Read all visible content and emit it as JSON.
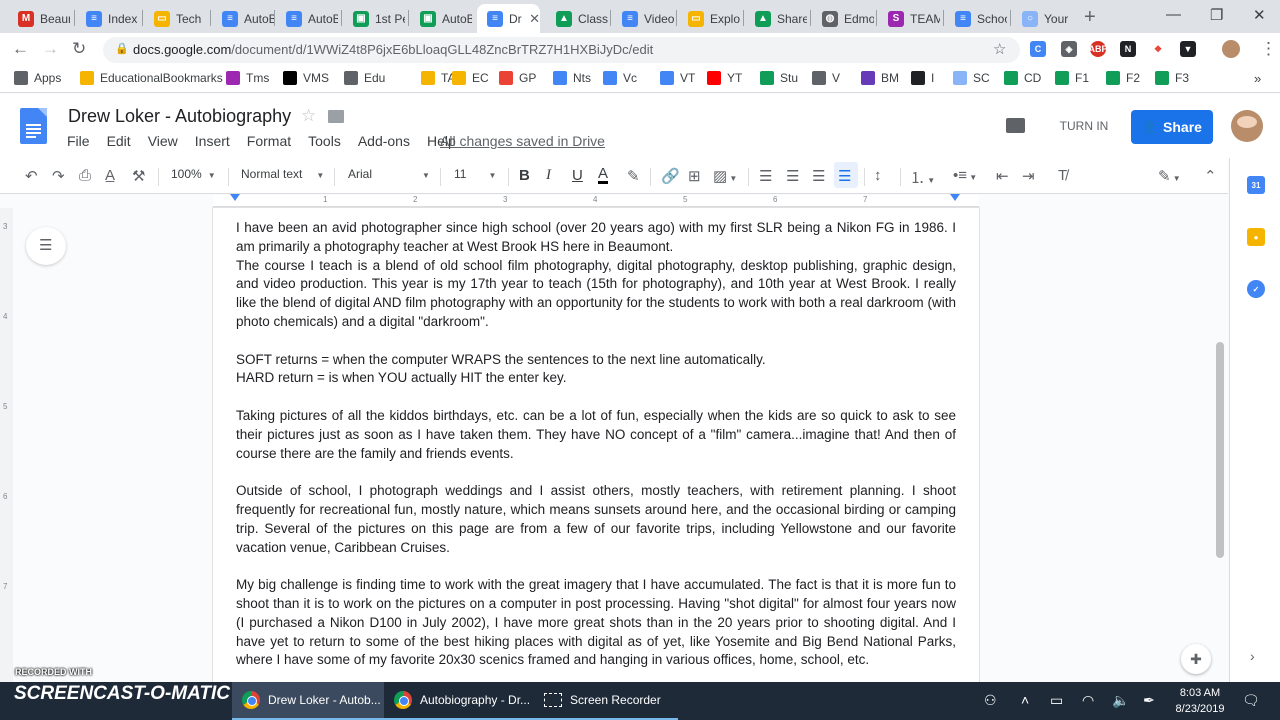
{
  "browser": {
    "tabs": [
      {
        "label": "Beaum",
        "icon": "gmail-icon",
        "color": "#d93025",
        "glyph": "M"
      },
      {
        "label": "Index",
        "icon": "docs-icon",
        "color": "#4285f4",
        "glyph": "≡"
      },
      {
        "label": "Tech",
        "icon": "slides-icon",
        "color": "#f4b400",
        "glyph": "▭"
      },
      {
        "label": "AutoB",
        "icon": "docs-icon",
        "color": "#4285f4",
        "glyph": "≡"
      },
      {
        "label": "AutoB",
        "icon": "docs-icon",
        "color": "#4285f4",
        "glyph": "≡"
      },
      {
        "label": "1st Pe",
        "icon": "classroom-icon",
        "color": "#0f9d58",
        "glyph": "▣"
      },
      {
        "label": "AutoB",
        "icon": "classroom-icon",
        "color": "#0f9d58",
        "glyph": "▣"
      },
      {
        "label": "Dr",
        "icon": "docs-icon",
        "color": "#4285f4",
        "glyph": "≡",
        "active": true
      },
      {
        "label": "Classr",
        "icon": "drive-icon",
        "color": "#0f9d58",
        "glyph": "▲"
      },
      {
        "label": "Video",
        "icon": "docs-icon",
        "color": "#4285f4",
        "glyph": "≡"
      },
      {
        "label": "Explo",
        "icon": "slides-icon",
        "color": "#f4b400",
        "glyph": "▭"
      },
      {
        "label": "Share",
        "icon": "drive-icon",
        "color": "#0f9d58",
        "glyph": "▲"
      },
      {
        "label": "Edmo",
        "icon": "globe-icon",
        "color": "#5f6368",
        "glyph": "◍"
      },
      {
        "label": "TEAM",
        "icon": "team-icon",
        "color": "#9c27b0",
        "glyph": "S"
      },
      {
        "label": "Schoo",
        "icon": "docs-icon",
        "color": "#4285f4",
        "glyph": "≡"
      },
      {
        "label": "Your",
        "icon": "loading-icon",
        "color": "#8ab4f8",
        "glyph": "○"
      }
    ],
    "url_host": "docs.google.com",
    "url_path": "/document/d/1WWiZ4t8P6jxE6bLloaqGLL48ZncBrTRZ7H1HXBiJyDc/edit",
    "bookmarks": [
      {
        "label": "Apps",
        "icon": "apps-grid-icon",
        "color": "#5f6368"
      },
      {
        "label": "EducationalBookmarks",
        "icon": "folder-icon",
        "color": "#f4b400"
      },
      {
        "label": "Tms",
        "icon": "team-icon",
        "color": "#9c27b0"
      },
      {
        "label": "VMS",
        "icon": "bb-icon",
        "color": "#000000"
      },
      {
        "label": "Edu",
        "icon": "globe-icon",
        "color": "#5f6368"
      },
      {
        "label": "TA",
        "icon": "folder-icon",
        "color": "#f4b400"
      },
      {
        "label": "EC",
        "icon": "folder-icon",
        "color": "#f4b400"
      },
      {
        "label": "GP",
        "icon": "photos-icon",
        "color": "#ea4335"
      },
      {
        "label": "Nts",
        "icon": "docs-icon",
        "color": "#4285f4"
      },
      {
        "label": "Vc",
        "icon": "docs-icon",
        "color": "#4285f4"
      },
      {
        "label": "VT",
        "icon": "docs-icon",
        "color": "#4285f4"
      },
      {
        "label": "YT",
        "icon": "youtube-icon",
        "color": "#ff0000"
      },
      {
        "label": "Stu",
        "icon": "sheets-icon",
        "color": "#0f9d58"
      },
      {
        "label": "V",
        "icon": "eye-icon",
        "color": "#5f6368"
      },
      {
        "label": "BM",
        "icon": "forms-icon",
        "color": "#673ab7"
      },
      {
        "label": "I",
        "icon": "runner-icon",
        "color": "#202124"
      },
      {
        "label": "SC",
        "icon": "circle-icon",
        "color": "#8ab4f8"
      },
      {
        "label": "CD",
        "icon": "drive-icon",
        "color": "#0f9d58"
      },
      {
        "label": "F1",
        "icon": "classroom-icon",
        "color": "#0f9d58"
      },
      {
        "label": "F2",
        "icon": "classroom-icon",
        "color": "#0f9d58"
      },
      {
        "label": "F3",
        "icon": "classroom-icon",
        "color": "#0f9d58"
      }
    ]
  },
  "docs": {
    "title": "Drew Loker - Autobiography",
    "menu": [
      "File",
      "Edit",
      "View",
      "Insert",
      "Format",
      "Tools",
      "Add-ons",
      "Help"
    ],
    "saved_status": "All changes saved in Drive",
    "turn_in_label": "TURN IN",
    "share_label": "Share",
    "toolbar": {
      "zoom": "100%",
      "style": "Normal text",
      "font": "Arial",
      "size": "11"
    },
    "ruler_numbers": [
      "1",
      "2",
      "3",
      "4",
      "5",
      "6",
      "7"
    ],
    "vertical_ruler_numbers": [
      "3",
      "4",
      "5",
      "6",
      "7"
    ],
    "paragraphs": [
      "I have been an avid photographer since high school (over 20 years ago) with my first SLR being a Nikon FG in 1986. I am primarily a photography teacher at West Brook HS here in Beaumont.",
      "The course I teach is a blend of old school film photography, digital photography, desktop publishing, graphic design, and video production. This year is my 17th year to teach (15th for photography), and 10th year at West Brook. I really like the blend of digital AND film photography with an opportunity for the students to work with both a real darkroom (with photo chemicals) and a digital \"darkroom\".",
      "",
      "SOFT returns = when the computer WRAPS the sentences to the next line automatically.",
      "HARD return = is when YOU actually HIT the enter key.",
      "",
      "Taking pictures of all the kiddos birthdays, etc. can be a lot of fun, especially when the kids are so quick to ask to see their pictures just as soon as I have taken them. They have NO concept of a \"film\" camera...imagine that! And then of course there are the family and friends events.",
      "",
      "Outside of school, I photograph weddings and I assist others, mostly teachers, with retirement planning. I shoot frequently for recreational fun, mostly nature, which means sunsets around here, and the occasional birding or camping trip. Several of the pictures on this page are from a few of our favorite trips, including Yellowstone and our favorite vacation venue, Caribbean Cruises.",
      "",
      "My big challenge is finding time to work with the great imagery that I have accumulated. The fact is that it is more fun to shoot than it is to work on the pictures on a computer in post processing. Having \"shot digital\" for almost four years now (I purchased a Nikon D100 in July 2002), I have more great shots than in the 20 years prior to shooting digital. And I have yet to return to some of the best hiking places with digital as of yet, like Yosemite and Big Bend National Parks, where I have some of my favorite 20x30 scenics framed and hanging in various offices, home, school, etc."
    ]
  },
  "taskbar": {
    "items": [
      {
        "label": "Drew Loker - Autob..."
      },
      {
        "label": "Autobiography - Dr..."
      },
      {
        "label": "Screen Recorder"
      }
    ],
    "time": "8:03 AM",
    "date": "8/23/2019",
    "watermark_top": "RECORDED WITH",
    "watermark_brand": "SCREENCAST-O-MATIC"
  }
}
